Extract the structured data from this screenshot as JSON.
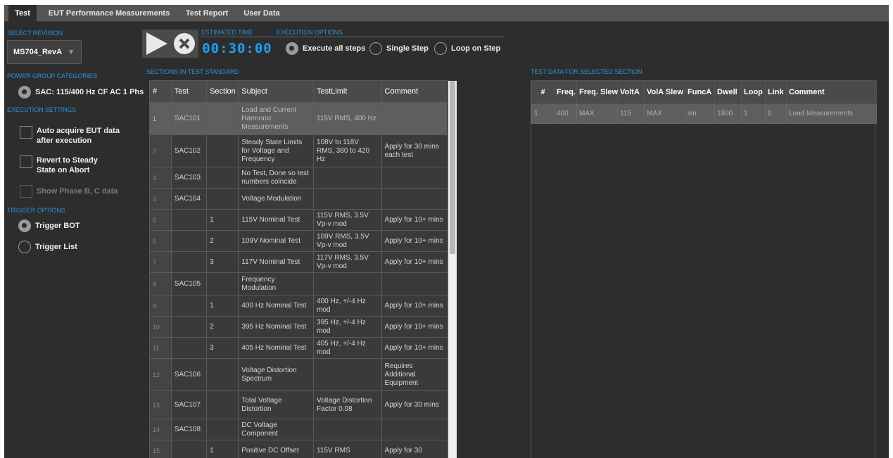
{
  "tabs": [
    {
      "label": "Test",
      "active": true
    },
    {
      "label": "EUT Performance Measurements",
      "active": false
    },
    {
      "label": "Test Report",
      "active": false
    },
    {
      "label": "User Data",
      "active": false
    }
  ],
  "left": {
    "select_revision_label": "SELECT REVISION",
    "revision_value": "MS704_RevA",
    "power_group_label": "POWER GROUP CATEGORIES",
    "power_group_value": "SAC: 115/400 Hz CF AC 1 Phs",
    "execution_settings_label": "EXECUTION SETTINGS",
    "checkboxes": [
      {
        "label": "Auto acquire EUT data after execution",
        "checked": false,
        "enabled": true
      },
      {
        "label": "Revert to Steady State on Abort",
        "checked": false,
        "enabled": true
      },
      {
        "label": "Show Phase B, C data",
        "checked": false,
        "enabled": false
      }
    ],
    "trigger_options_label": "TRIGGER OPTIONS",
    "trigger_options": [
      {
        "label": "Trigger BOT",
        "selected": true
      },
      {
        "label": "Trigger List",
        "selected": false
      }
    ]
  },
  "controls": {
    "estimated_time_label": "ESTIMATED TIME",
    "estimated_time": "00:30:00",
    "execution_options_label": "EXECUTION OPTIONS",
    "execution_options": [
      {
        "label": "Execute all steps",
        "selected": true
      },
      {
        "label": "Single Step",
        "selected": false
      },
      {
        "label": "Loop on Step",
        "selected": false
      }
    ]
  },
  "sections_table": {
    "label": "SECTIONS IN TEST STANDARD",
    "headers": [
      "#",
      "Test",
      "Section",
      "Subject",
      "TestLimit",
      "Comment"
    ],
    "rows": [
      [
        "1",
        "SAC101",
        "",
        "Load and Current Harmonic Measurements",
        "115V RMS, 400 Hz",
        ""
      ],
      [
        "2",
        "SAC102",
        "",
        "Steady State Limits for Voltage and Frequency",
        "108V to 118V RMS, 380 to 420 Hz",
        "Apply for 30 mins each test"
      ],
      [
        "3",
        "SAC103",
        "",
        "No Test, Done so test numbers coincide",
        "",
        ""
      ],
      [
        "4",
        "SAC104",
        "",
        "Voltage Modulation",
        "",
        ""
      ],
      [
        "5",
        "",
        "1",
        "115V Nominal Test",
        "115V RMS, 3.5V Vp-v mod",
        "Apply for 10+ mins"
      ],
      [
        "6",
        "",
        "2",
        "109V Nominal Test",
        "109V RMS, 3.5V Vp-v mod",
        "Apply for 10+ mins"
      ],
      [
        "7",
        "",
        "3",
        "117V Nominal Test",
        "117V RMS, 3.5V Vp-v mod",
        "Apply for 10+ mins"
      ],
      [
        "8",
        "SAC105",
        "",
        "Frequency Modulation",
        "",
        ""
      ],
      [
        "9",
        "",
        "1",
        "400 Hz Nominal Test",
        "400 Hz, +/-4 Hz mod",
        "Apply for 10+ mins"
      ],
      [
        "10",
        "",
        "2",
        "395 Hz Nominal Test",
        "395 Hz, +/-4 Hz mod",
        "Apply for 10+ mins"
      ],
      [
        "11",
        "",
        "3",
        "405 Hz Nominal Test",
        "405 Hz, +/-4 Hz mod",
        "Apply for 10+ mins"
      ],
      [
        "12",
        "SAC106",
        "",
        "Voltage Distortion Spectrum",
        "",
        "Requires Additional Equipment"
      ],
      [
        "13",
        "SAC107",
        "",
        "Total Voltage Distortion",
        "Voltage Distortion Factor 0.08",
        "Apply for 30 mins"
      ],
      [
        "14",
        "SAC108",
        "",
        "DC Voltage Component",
        "",
        ""
      ],
      [
        "15",
        "",
        "1",
        "Positive DC Offset",
        "115V RMS",
        "Apply for 30"
      ]
    ]
  },
  "test_data_table": {
    "label": "TEST DATA FOR SELECTED SECTION",
    "headers": [
      "#",
      "Freq.",
      "Freq. Slew",
      "VoltA",
      "VolA Slew",
      "FuncA",
      "Dwell",
      "Loop",
      "Link",
      "Comment"
    ],
    "rows": [
      [
        "1",
        "400",
        "MAX",
        "115",
        "MAX",
        "sin",
        "1800",
        "1",
        "0",
        "Load Measurements"
      ]
    ]
  }
}
